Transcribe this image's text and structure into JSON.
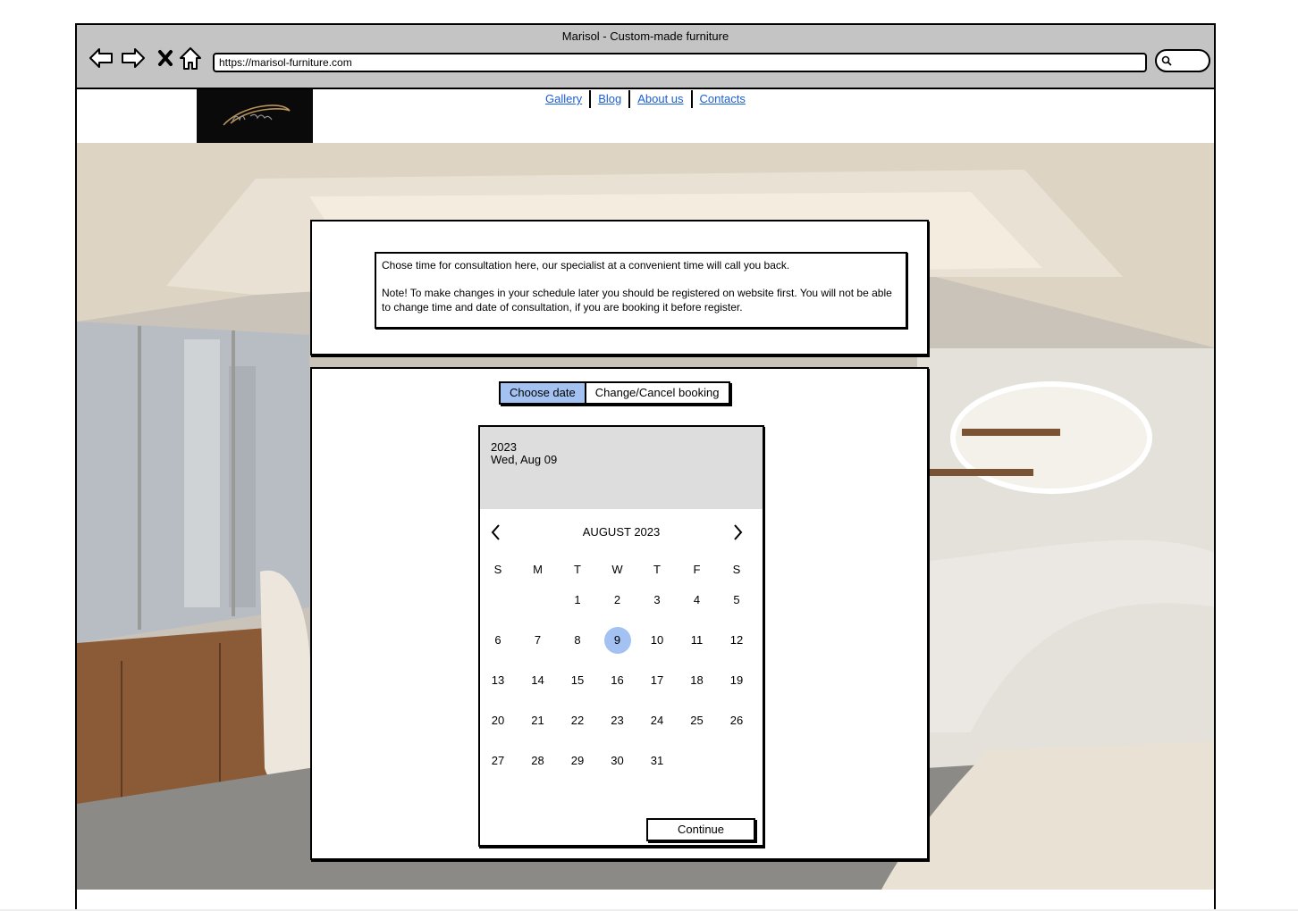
{
  "window": {
    "title": "Marisol - Custom-made furniture"
  },
  "browser": {
    "url": "https://marisol-furniture.com",
    "nav_icons": [
      "back-arrow-icon",
      "forward-arrow-icon",
      "close-x-icon",
      "home-icon"
    ],
    "search_icon": "search-icon"
  },
  "site": {
    "logo_icon": "marisol-logo-icon",
    "menu": [
      "Gallery",
      "Blog",
      "About us",
      "Contacts"
    ]
  },
  "info": {
    "line1": "Chose time for consultation here, our specialist at a convenient time will call you back.",
    "line2": "Note! To make changes in your schedule later you should be registered on website first. You will not be able to change time and date of consultation, if you are booking it before register."
  },
  "tabs": {
    "choose_date": "Choose date",
    "change_cancel": "Change/Cancel booking",
    "active": "Choose date"
  },
  "calendar": {
    "year": "2023",
    "selected_label": "Wed, Aug 09",
    "month_label": "AUGUST 2023",
    "weekdays": [
      "S",
      "M",
      "T",
      "W",
      "T",
      "F",
      "S"
    ],
    "first_weekday_index": 2,
    "days_in_month": 31,
    "selected_day": 9,
    "prev_icon": "chevron-left-icon",
    "next_icon": "chevron-right-icon"
  },
  "actions": {
    "continue": "Continue"
  },
  "colors": {
    "accent": "#a3c2f2",
    "link": "#1a5fd6",
    "chrome": "#c4c4c4"
  }
}
